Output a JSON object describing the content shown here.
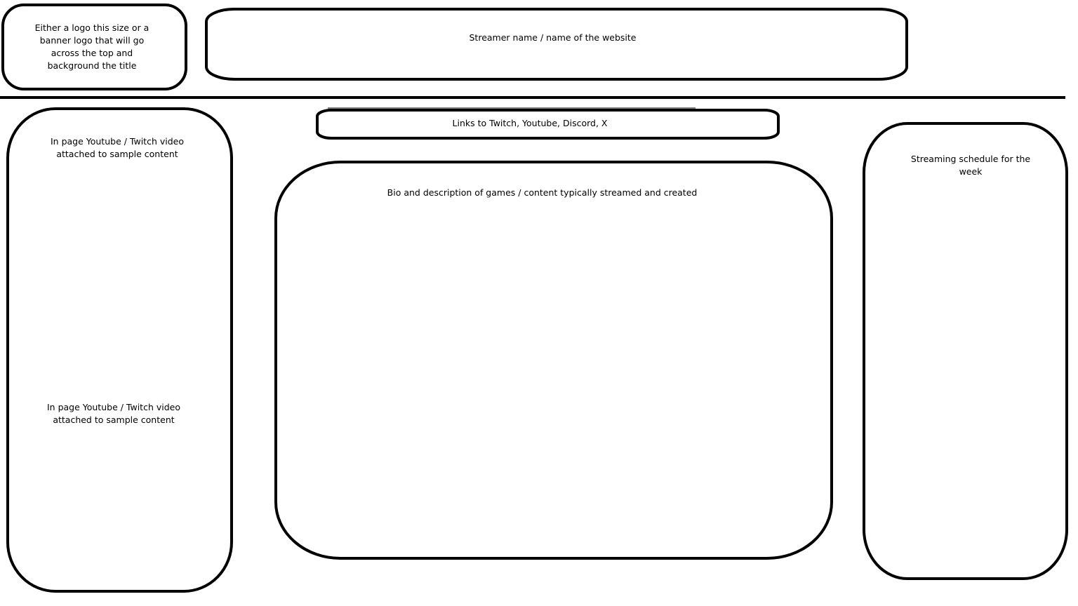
{
  "header": {
    "logo_box_text": "Either a logo this size or a banner logo that will go across the top and background the title",
    "title_box_text": "Streamer name / name of the website"
  },
  "links_box_text": "Links to Twitch, Youtube, Discord, X",
  "left_column": {
    "video_1_text": "In page Youtube / Twitch video attached to sample content",
    "video_2_text": "In page Youtube / Twitch video attached to sample content"
  },
  "bio_box_text": "Bio and description of games / content typically streamed and created",
  "schedule_box_text": "Streaming schedule for the week",
  "colors": {
    "stroke": "#000000",
    "background": "#ffffff"
  }
}
